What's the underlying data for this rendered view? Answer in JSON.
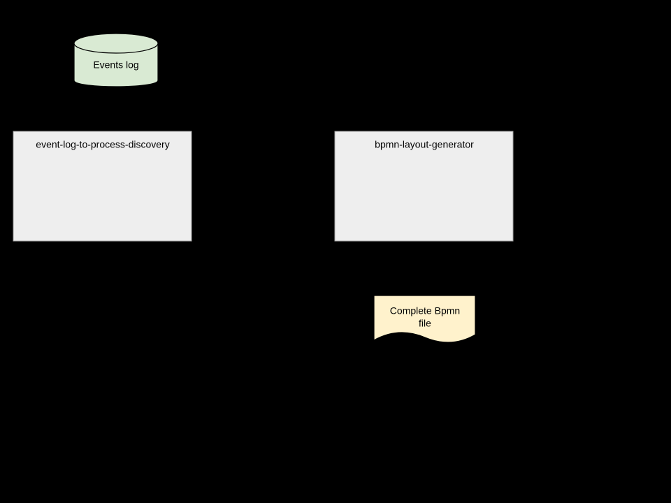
{
  "diagram": {
    "cylinder": {
      "label": "Events log",
      "fill": "#d9ead3",
      "stroke": "#000000"
    },
    "box_left": {
      "label": "event-log-to-process-discovery",
      "fill": "#eeeeee",
      "stroke": "#a0a0a0",
      "shadow": "#000000"
    },
    "box_right": {
      "label": "bpmn-layout-generator",
      "fill": "#eeeeee",
      "stroke": "#a0a0a0",
      "shadow": "#000000"
    },
    "note": {
      "line1": "Complete Bpmn",
      "line2": "file",
      "fill": "#fff2cc",
      "stroke": "#000000",
      "shadow": "#000000"
    }
  }
}
